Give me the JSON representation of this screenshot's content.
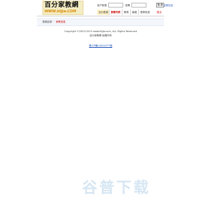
{
  "header": {
    "logo_main": "百分家教網",
    "logo_sub": "WWW.bfjjw.COM",
    "login": {
      "username_label": "用户帐號",
      "password_label": "密碼",
      "login_button": "登 录",
      "register_link": "註冊",
      "forgot_link": "忘記"
    },
    "nav": [
      {
        "label": "百分首頁",
        "active": false
      },
      {
        "label": "家教列表",
        "active": true
      },
      {
        "label": "教員",
        "active": false
      },
      {
        "label": "論壇",
        "active": false
      },
      {
        "label": "發佈信息",
        "active": false
      }
    ],
    "nav_right": "退出"
  },
  "breadcrumb": {
    "home": "首頁目錄",
    "separator": "›",
    "current": "家教信息"
  },
  "footer": {
    "copyright": "Copyright ©2003-2010 www.bfjjw.com, ALL Rights Reserved",
    "site_note": "百分家教網 版權所有",
    "icp": "粵ICP備14004377號"
  },
  "watermark": "谷普下载",
  "colors": {
    "accent_red": "#cc0000",
    "link_blue": "#1a4fb5",
    "logo_bg": "#f4ecc4",
    "logo_orange": "#d88a00",
    "watermark": "#d6e6f3"
  }
}
